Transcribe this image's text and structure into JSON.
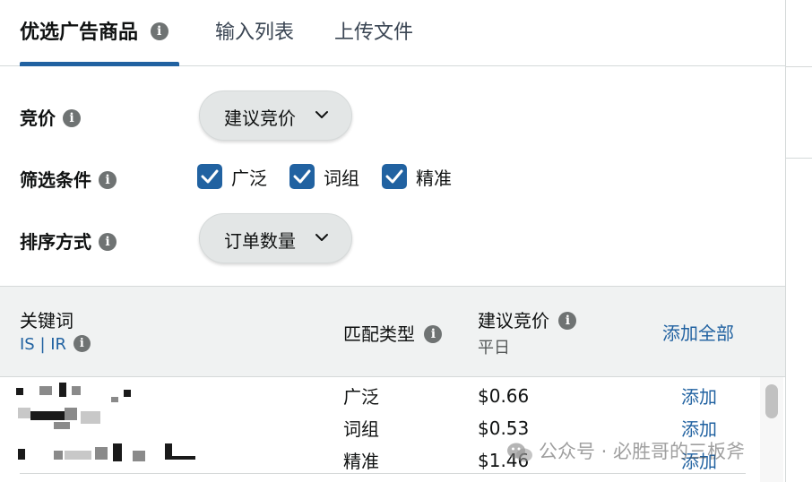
{
  "tabs": [
    {
      "label": "优选广告商品",
      "active": true
    },
    {
      "label": "输入列表",
      "active": false
    },
    {
      "label": "上传文件",
      "active": false
    }
  ],
  "form": {
    "bid": {
      "label": "竞价",
      "value": "建议竞价"
    },
    "filter": {
      "label": "筛选条件",
      "options": [
        {
          "label": "广泛",
          "checked": true
        },
        {
          "label": "词组",
          "checked": true
        },
        {
          "label": "精准",
          "checked": true
        }
      ]
    },
    "sort": {
      "label": "排序方式",
      "value": "订单数量"
    }
  },
  "table": {
    "headers": {
      "keyword": "关键词",
      "keyword_sub": "IS | IR",
      "match_type": "匹配类型",
      "suggested_bid": "建议竞价",
      "suggested_bid_sub": "平日",
      "add_all": "添加全部"
    },
    "rows": [
      {
        "match_type": "广泛",
        "bid": "$0.66",
        "action": "添加"
      },
      {
        "match_type": "词组",
        "bid": "$0.53",
        "action": "添加"
      },
      {
        "match_type": "精准",
        "bid": "$1.46",
        "action": "添加"
      }
    ]
  },
  "watermark": "公众号 · 必胜哥的三板斧",
  "colors": {
    "accent": "#2162a1",
    "header_bg": "#f0f2f2",
    "pill_bg": "#e3e6e6"
  }
}
